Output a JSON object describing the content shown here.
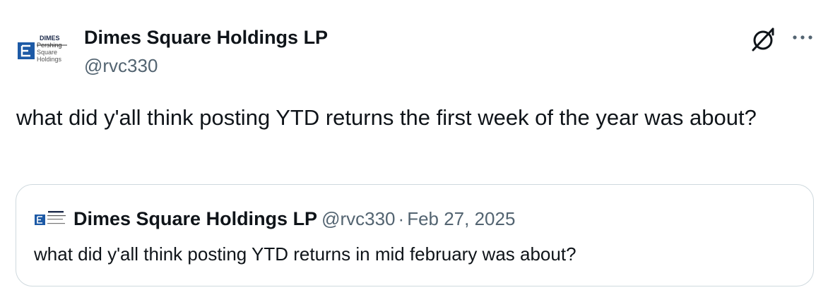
{
  "tweet": {
    "author": {
      "display_name": "Dimes Square Holdings LP",
      "handle": "@rvc330",
      "avatar_logo": {
        "line1": "DIMES",
        "line2": "Pershing",
        "line3": "Square",
        "line4": "Holdings"
      }
    },
    "text": "what did y'all think posting YTD returns the first week of the year was about?",
    "actions": {
      "grok_icon": "grok-icon",
      "more_icon": "more-icon"
    },
    "quoted": {
      "display_name": "Dimes Square Holdings LP",
      "handle": "@rvc330",
      "separator": "·",
      "date": "Feb 27, 2025",
      "text": "what did y'all think posting YTD returns in mid february was about?"
    }
  },
  "colors": {
    "text": "#0f1419",
    "secondary": "#536471",
    "border": "#cfd9de",
    "logo_blue": "#1d5aa6"
  }
}
